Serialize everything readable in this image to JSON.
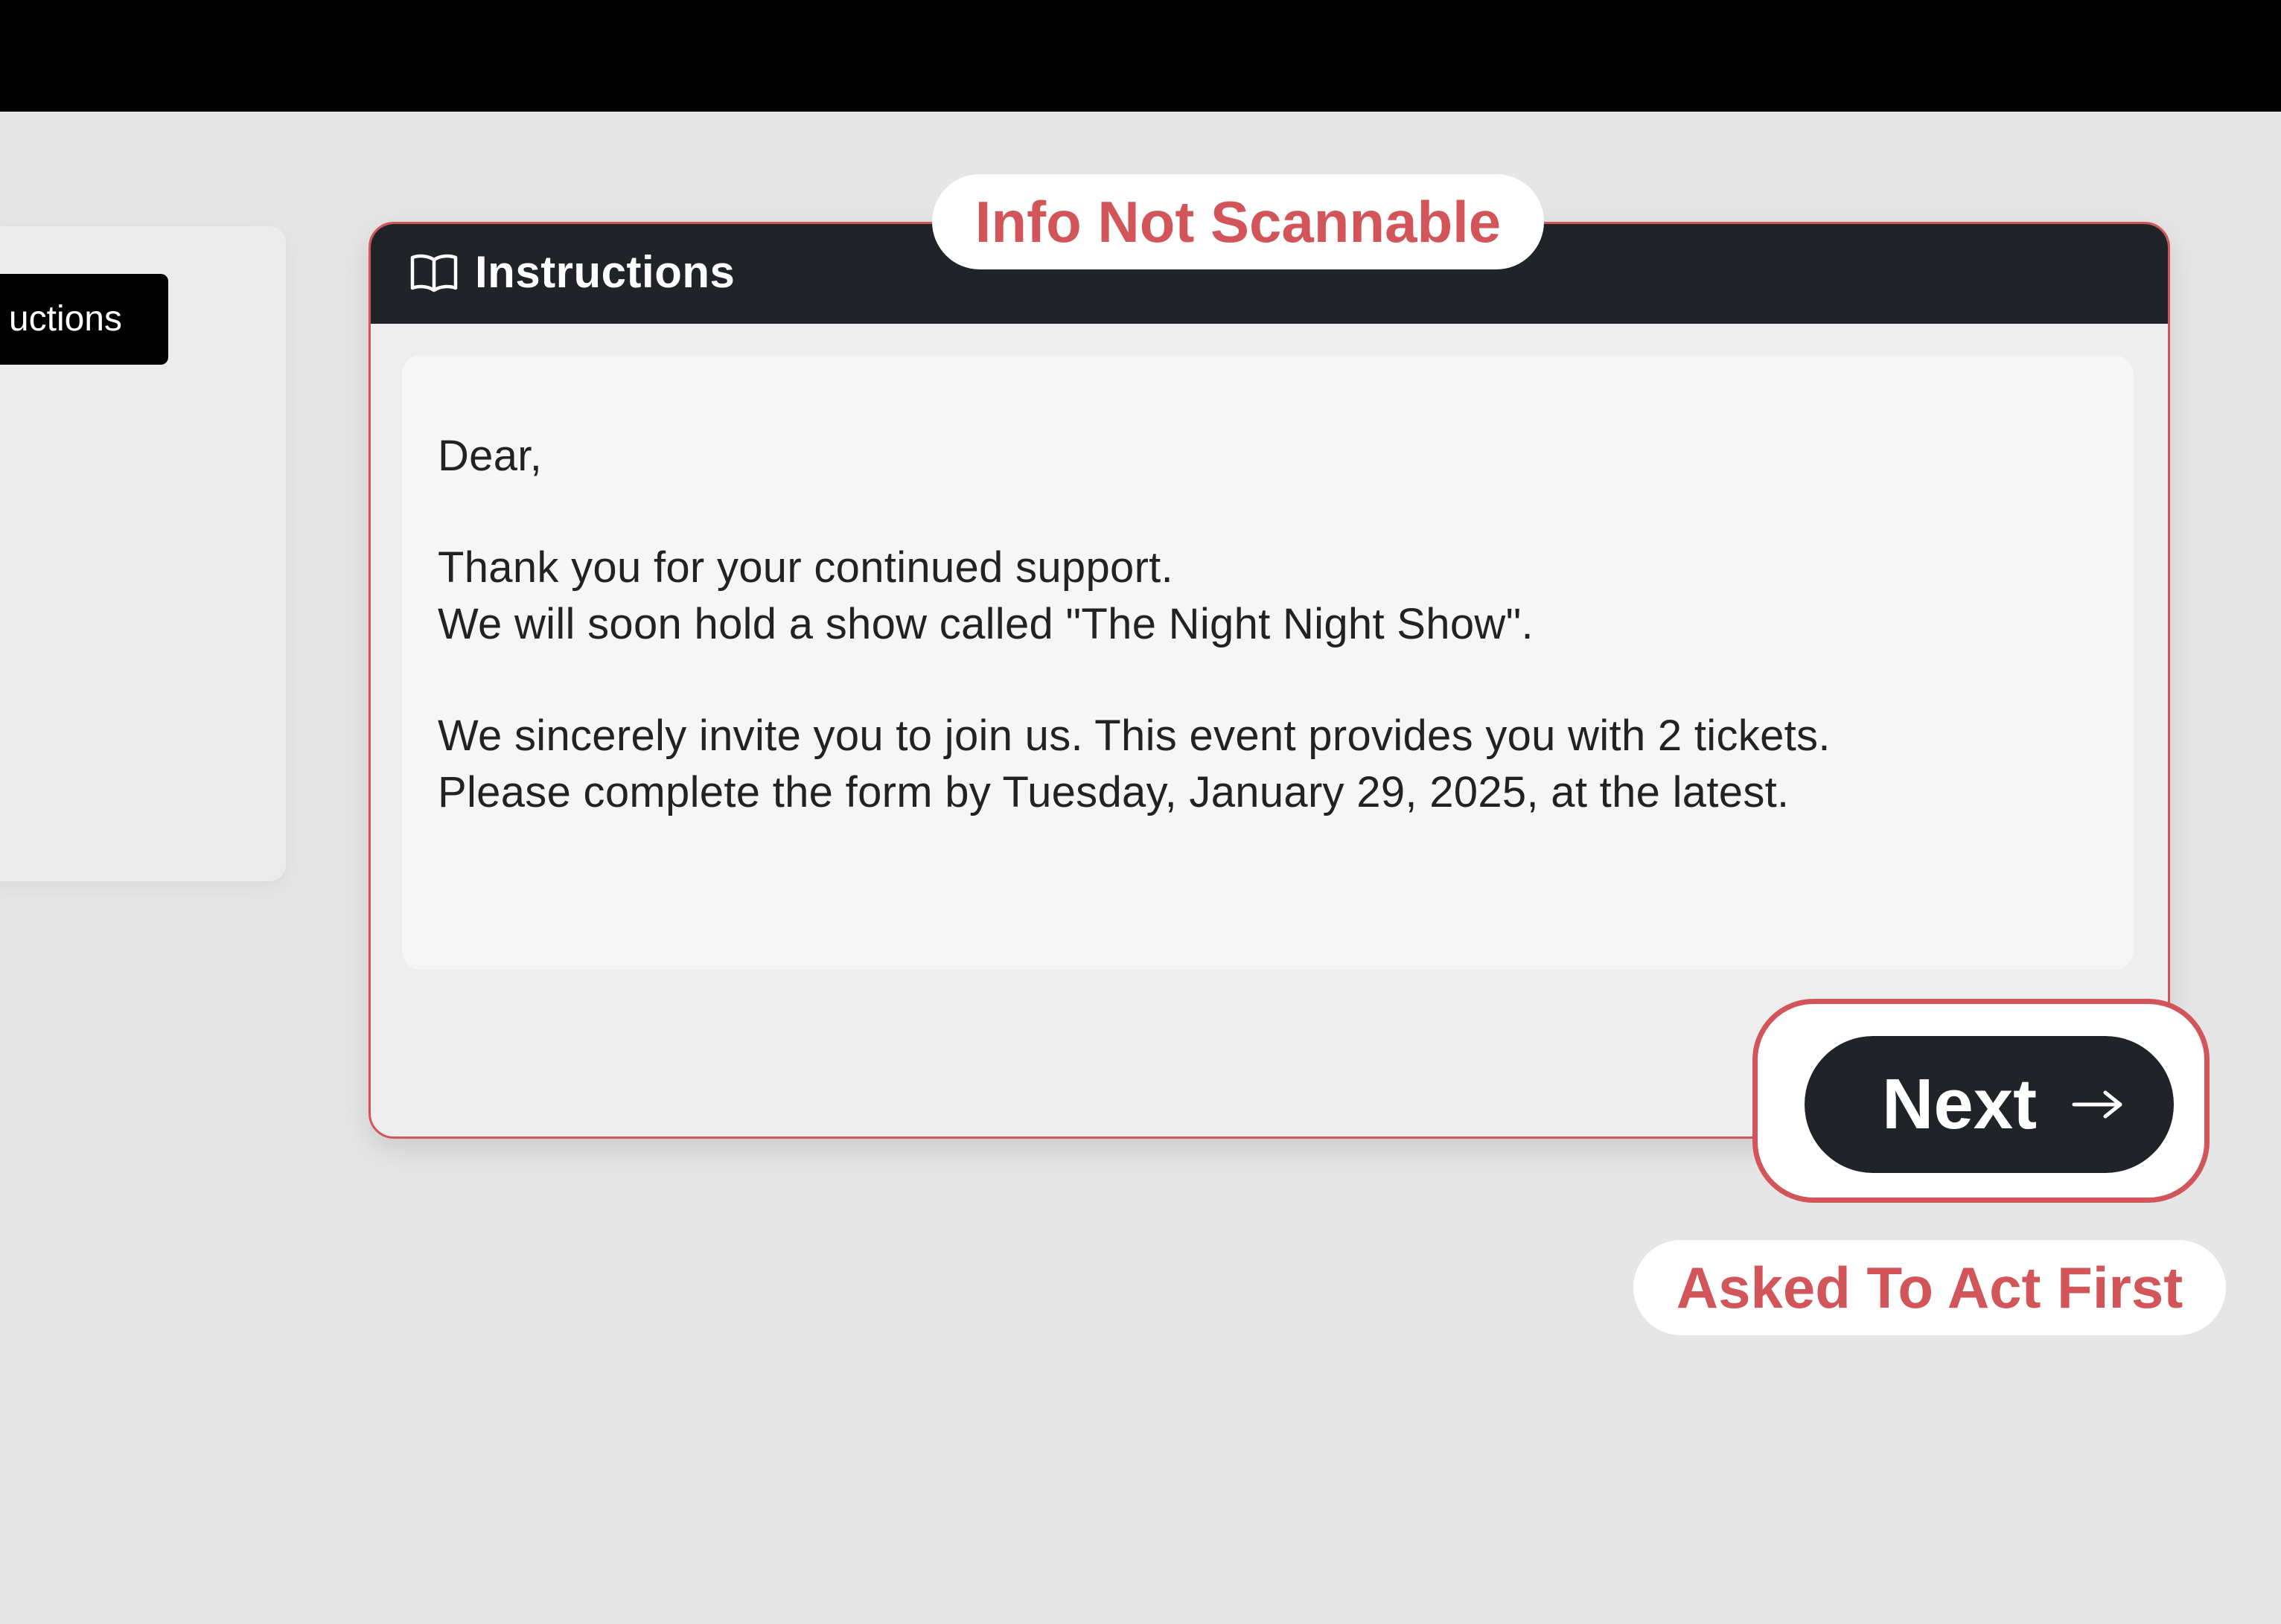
{
  "background_tab": {
    "label": "uctions"
  },
  "instructions": {
    "title": "Instructions",
    "icon": "book-icon",
    "letter": {
      "greeting": "Dear,",
      "line1": "Thank you for your continued support.",
      "line2": "We will soon hold a show called \"The Night Night Show\".",
      "line3": "We sincerely invite you to join us. This event provides you with 2 tickets.",
      "line4": "Please complete the form by Tuesday, January 29, 2025, at the latest."
    }
  },
  "next_button": {
    "label": "Next",
    "icon": "arrow-right-icon"
  },
  "annotations": {
    "top": "Info Not Scannable",
    "bottom": "Asked To Act First"
  },
  "colors": {
    "annotation_red": "#d2555a",
    "header_dark": "#202328",
    "page_background": "#e6e6e6"
  }
}
